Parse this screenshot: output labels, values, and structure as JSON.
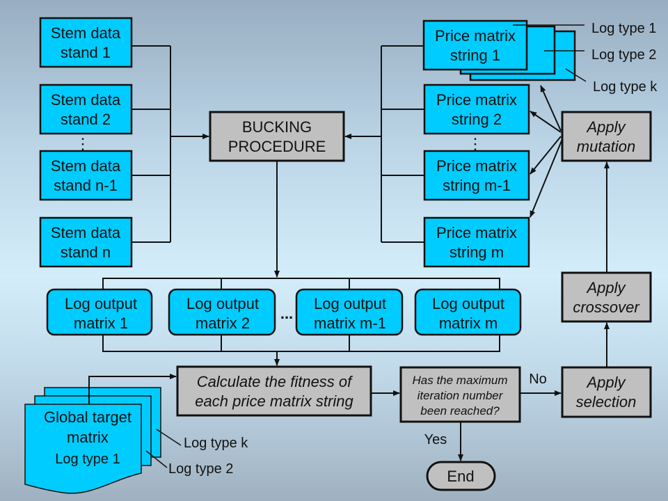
{
  "stem_data": [
    {
      "line1": "Stem data",
      "line2": "stand 1"
    },
    {
      "line1": "Stem data",
      "line2": "stand 2"
    },
    {
      "line1": "Stem data",
      "line2": "stand n-1"
    },
    {
      "line1": "Stem data",
      "line2": "stand n"
    }
  ],
  "ellipsis_vertical": "⋮",
  "ellipsis": "...",
  "bucking": {
    "line1": "BUCKING",
    "line2": "PROCEDURE"
  },
  "price_matrix": [
    {
      "line1": "Price matrix",
      "line2": "string 1"
    },
    {
      "line1": "Price matrix",
      "line2": "string 2"
    },
    {
      "line1": "Price matrix",
      "line2": "string m-1"
    },
    {
      "line1": "Price matrix",
      "line2": "string m"
    }
  ],
  "log_types_top": [
    "Log type 1",
    "Log type 2",
    "Log type k"
  ],
  "mutation": {
    "line1": "Apply",
    "line2": "mutation"
  },
  "crossover": {
    "line1": "Apply",
    "line2": "crossover"
  },
  "selection": {
    "line1": "Apply",
    "line2": "selection"
  },
  "log_output": [
    {
      "line1": "Log output",
      "line2": "matrix 1"
    },
    {
      "line1": "Log output",
      "line2": "matrix 2"
    },
    {
      "line1": "Log output",
      "line2": "matrix m-1"
    },
    {
      "line1": "Log output",
      "line2": "matrix m"
    }
  ],
  "fitness": {
    "line1": "Calculate the fitness of",
    "line2": "each price matrix string"
  },
  "decision": {
    "line1": "Has the maximum",
    "line2": "iteration number",
    "line3": "been reached?",
    "no": "No",
    "yes": "Yes"
  },
  "end": "End",
  "global_target": {
    "line1": "Global target",
    "line2": "matrix",
    "line3": "Log type 1",
    "stack_labels": [
      "Log type k",
      "Log type 2"
    ]
  },
  "colors": {
    "box": "#00ccff",
    "process": "#c0c0c0"
  }
}
